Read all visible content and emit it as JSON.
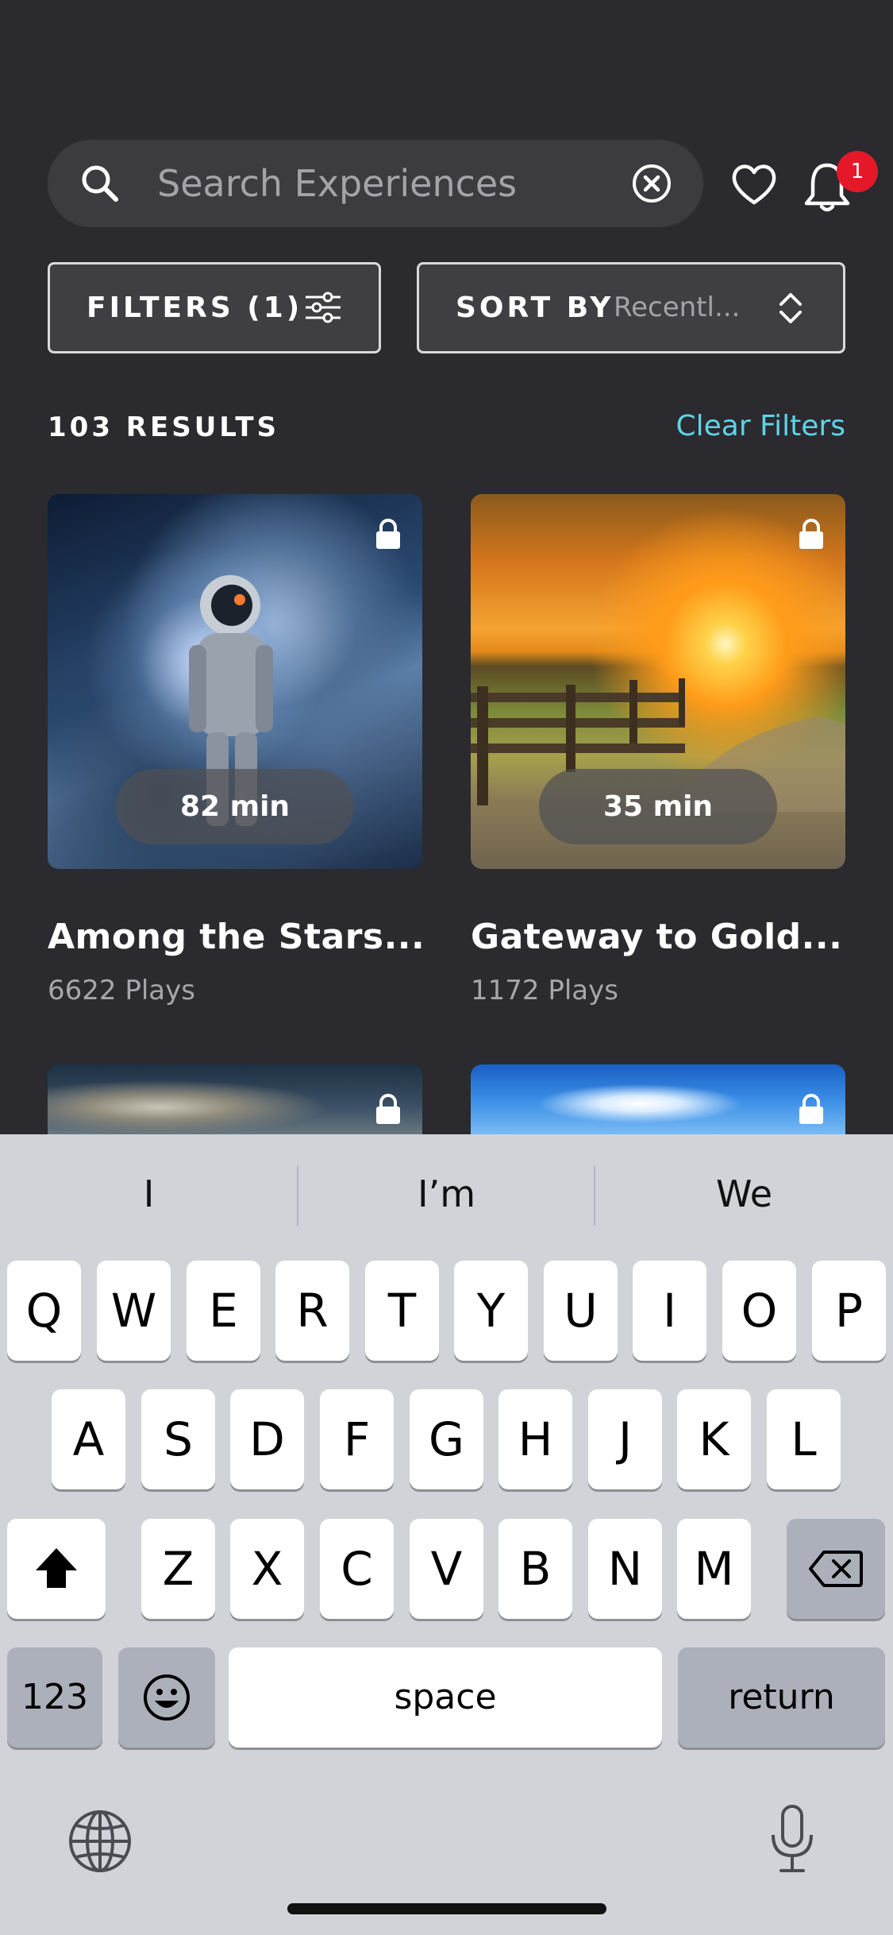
{
  "search": {
    "placeholder": "Search Experiences",
    "notification_count": "1"
  },
  "controls": {
    "filters_label": "FILTERS (1)",
    "sort_label": "SORT BY",
    "sort_value": "Recentl..."
  },
  "results": {
    "count_label": "103 RESULTS",
    "clear_filters": "Clear Filters"
  },
  "cards": [
    {
      "title": "Among the Stars...",
      "plays": "6622 Plays",
      "duration": "82 min",
      "locked": true
    },
    {
      "title": "Gateway to Gold...",
      "plays": "1172 Plays",
      "duration": "35 min",
      "locked": true
    }
  ],
  "keyboard": {
    "suggestions": [
      "I",
      "I’m",
      "We"
    ],
    "row1": [
      "Q",
      "W",
      "E",
      "R",
      "T",
      "Y",
      "U",
      "I",
      "O",
      "P"
    ],
    "row2": [
      "A",
      "S",
      "D",
      "F",
      "G",
      "H",
      "J",
      "K",
      "L"
    ],
    "row3": [
      "Z",
      "X",
      "C",
      "V",
      "B",
      "N",
      "M"
    ],
    "numbers_key": "123",
    "space_key": "space",
    "return_key": "return"
  },
  "colors": {
    "background": "#2a2a2f",
    "accent": "#5fd3e8",
    "badge": "#e5182a",
    "keyboard": "#d1d3d9"
  }
}
